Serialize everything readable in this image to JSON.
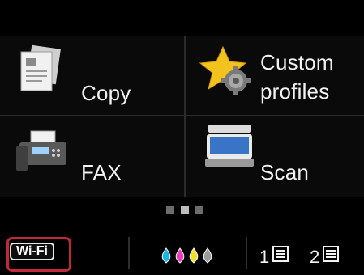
{
  "menu": {
    "copy_label": "Copy",
    "custom_label_line1": "Custom",
    "custom_label_line2": "profiles",
    "fax_label": "FAX",
    "scan_label": "Scan"
  },
  "status": {
    "wifi_label": "Wi-Fi",
    "ink_colors": [
      "#18b6e8",
      "#e83fb2",
      "#f2e12a",
      "#9a9a9a"
    ],
    "tray1_label": "1",
    "tray2_label": "2"
  },
  "colors": {
    "wifi_highlight": "#c3273a"
  }
}
